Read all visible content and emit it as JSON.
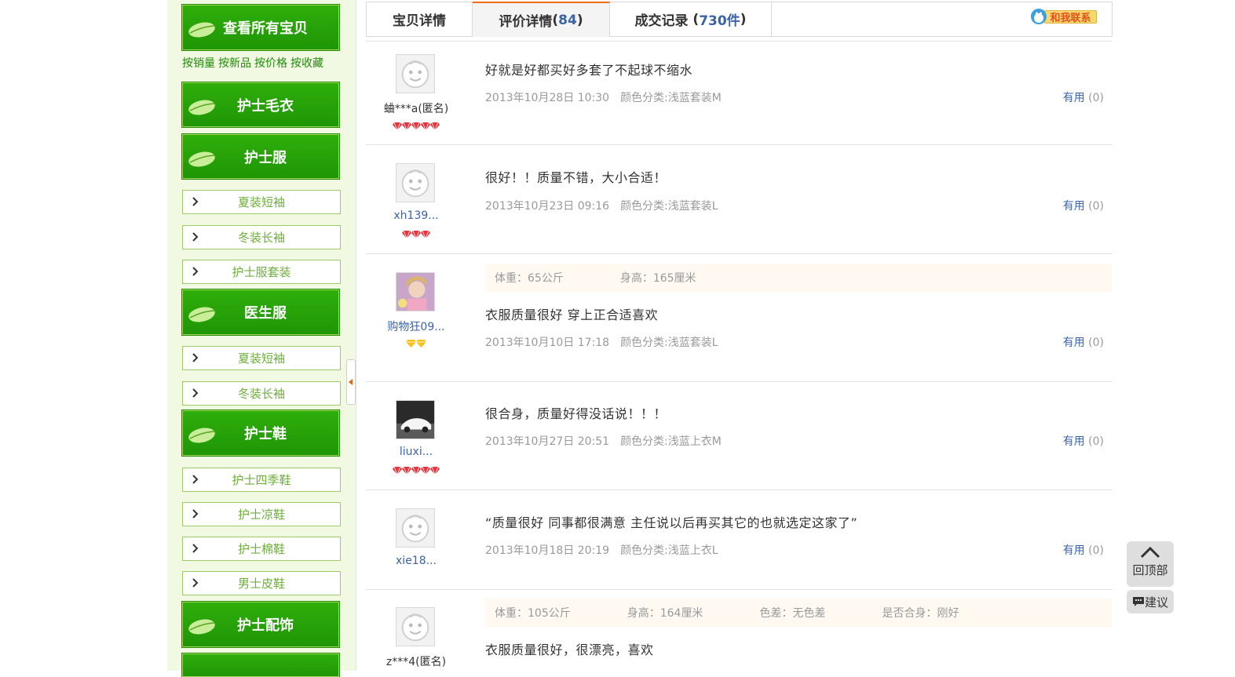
{
  "sidebar": {
    "all_items_label": "查看所有宝贝",
    "sort_links": [
      "按销量",
      "按新品",
      "按价格",
      "按收藏"
    ],
    "categories": [
      {
        "label": "护士毛衣"
      },
      {
        "label": "护士服",
        "subs": [
          "夏装短袖",
          "冬装长袖",
          "护士服套装"
        ]
      },
      {
        "label": "医生服",
        "subs": [
          "夏装短袖",
          "冬装长袖"
        ]
      },
      {
        "label": "护士鞋",
        "subs": [
          "护士四季鞋",
          "护士凉鞋",
          "护士棉鞋",
          "男士皮鞋"
        ]
      },
      {
        "label": "护士配饰"
      }
    ]
  },
  "tabs": {
    "detail": "宝贝详情",
    "reviews_label": "评价详情",
    "reviews_count": "84",
    "records_label": "成交记录",
    "records_count": "730件",
    "contact": "和我联系"
  },
  "reviews": [
    {
      "user": "蛐***a(匿名)",
      "content": "好就是好都买好多套了不起球不缩水",
      "date": "2013年10月28日 10:30",
      "sku": "颜色分类:浅蓝套装M",
      "useful_label": "有用",
      "useful_count": "(0)"
    },
    {
      "user": "xh139...",
      "content": "很好！！质量不错，大小合适！",
      "date": "2013年10月23日 09:16",
      "sku": "颜色分类:浅蓝套装L",
      "useful_label": "有用",
      "useful_count": "(0)"
    },
    {
      "user": "购物狂09...",
      "weight": "体重：65公斤",
      "height": "身高：165厘米",
      "content": "衣服质量很好 穿上正合适喜欢",
      "date": "2013年10月10日 17:18",
      "sku": "颜色分类:浅蓝套装L",
      "useful_label": "有用",
      "useful_count": "(0)"
    },
    {
      "user": "liuxi...",
      "content": "很合身，质量好得没话说！！！",
      "date": "2013年10月27日 20:51",
      "sku": "颜色分类:浅蓝上衣M",
      "useful_label": "有用",
      "useful_count": "(0)"
    },
    {
      "user": "xie18...",
      "content": "“质量很好 同事都很满意 主任说以后再买其它的也就选定这家了”",
      "date": "2013年10月18日 20:19",
      "sku": "颜色分类:浅蓝上衣L",
      "useful_label": "有用",
      "useful_count": "(0)"
    },
    {
      "user": "z***4(匿名)",
      "weight": "体重：105公斤",
      "height": "身高：164厘米",
      "color_diff": "色差：无色差",
      "fit": "是否合身：刚好",
      "content": "衣服质量很好，很漂亮，喜欢"
    }
  ],
  "float": {
    "top": "回顶部",
    "suggest": "建议"
  }
}
